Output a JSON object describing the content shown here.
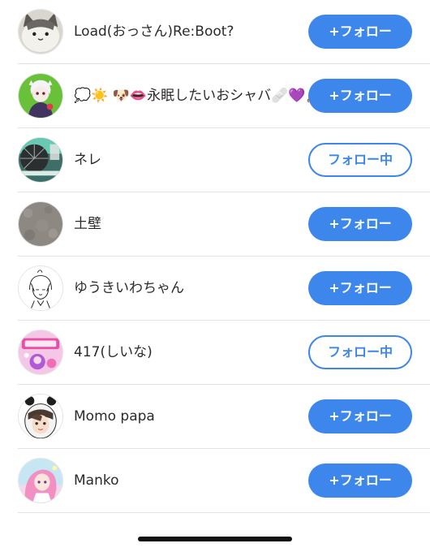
{
  "users": [
    {
      "name": "Load(おっさん)Re:Boot?",
      "button": "+フォロー",
      "state": "follow",
      "avatar_icon": "cat-plush-avatar"
    },
    {
      "name": "💭☀️ 🐶👄永眠したいおシャバ🩹💜🧸🧡",
      "button": "+フォロー",
      "state": "follow",
      "avatar_icon": "anime-character-avatar"
    },
    {
      "name": "ネレ",
      "button": "フォロー中",
      "state": "following",
      "avatar_icon": "umbrella-avatar"
    },
    {
      "name": "土壁",
      "button": "+フォロー",
      "state": "follow",
      "avatar_icon": "stone-wall-avatar"
    },
    {
      "name": "ゆうきいわちゃん",
      "button": "+フォロー",
      "state": "follow",
      "avatar_icon": "sketch-girl-avatar"
    },
    {
      "name": "417(しいな)",
      "button": "フォロー中",
      "state": "following",
      "avatar_icon": "stream-banner-avatar"
    },
    {
      "name": "Momo papa",
      "button": "+フォロー",
      "state": "follow",
      "avatar_icon": "bear-hood-avatar"
    },
    {
      "name": "Manko",
      "button": "+フォロー",
      "state": "follow",
      "avatar_icon": "pastel-girl-avatar"
    }
  ],
  "colors": {
    "accent": "#3d86ec",
    "divider": "#e3e3e7",
    "text": "#2b2b2b"
  }
}
